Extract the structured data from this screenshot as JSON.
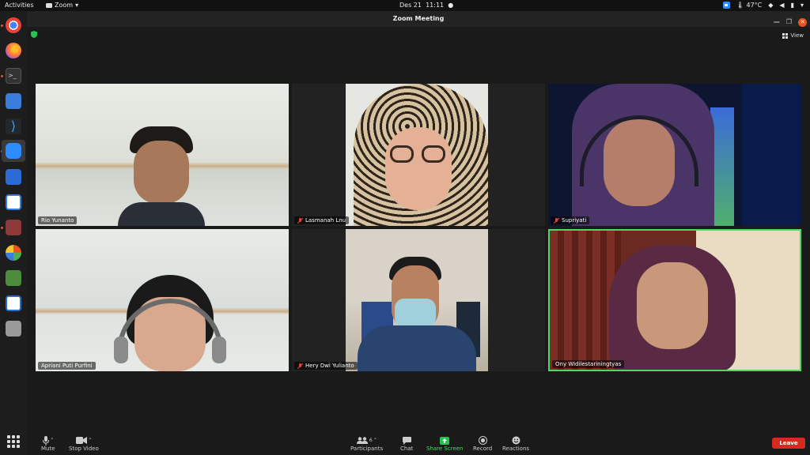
{
  "system_bar": {
    "activities": "Activities",
    "app_name": "Zoom",
    "date": "Des 21",
    "time": "11:11",
    "temperature": "47°C"
  },
  "window": {
    "title": "Zoom Meeting",
    "view_label": "View"
  },
  "participants_tiles": [
    {
      "name": "Rio Yunanto",
      "muted": false
    },
    {
      "name": "Lasmanah Lnu",
      "muted": true
    },
    {
      "name": "Supriyati",
      "muted": true
    },
    {
      "name": "Apriani Puti Purfini",
      "muted": false
    },
    {
      "name": "Hery Dwi Yulianto",
      "muted": true
    },
    {
      "name": "Ony Widilestariningtyas",
      "muted": false,
      "active_speaker": true
    }
  ],
  "toolbar": {
    "mute": "Mute",
    "stop_video": "Stop Video",
    "participants": "Participants",
    "participants_count": "6",
    "chat": "Chat",
    "share_screen": "Share Screen",
    "record": "Record",
    "reactions": "Reactions",
    "leave": "Leave"
  },
  "colors": {
    "accent_green": "#4cd964",
    "leave_red": "#d9281f",
    "ubuntu_orange": "#e95420",
    "muted_red": "#e0453a"
  }
}
